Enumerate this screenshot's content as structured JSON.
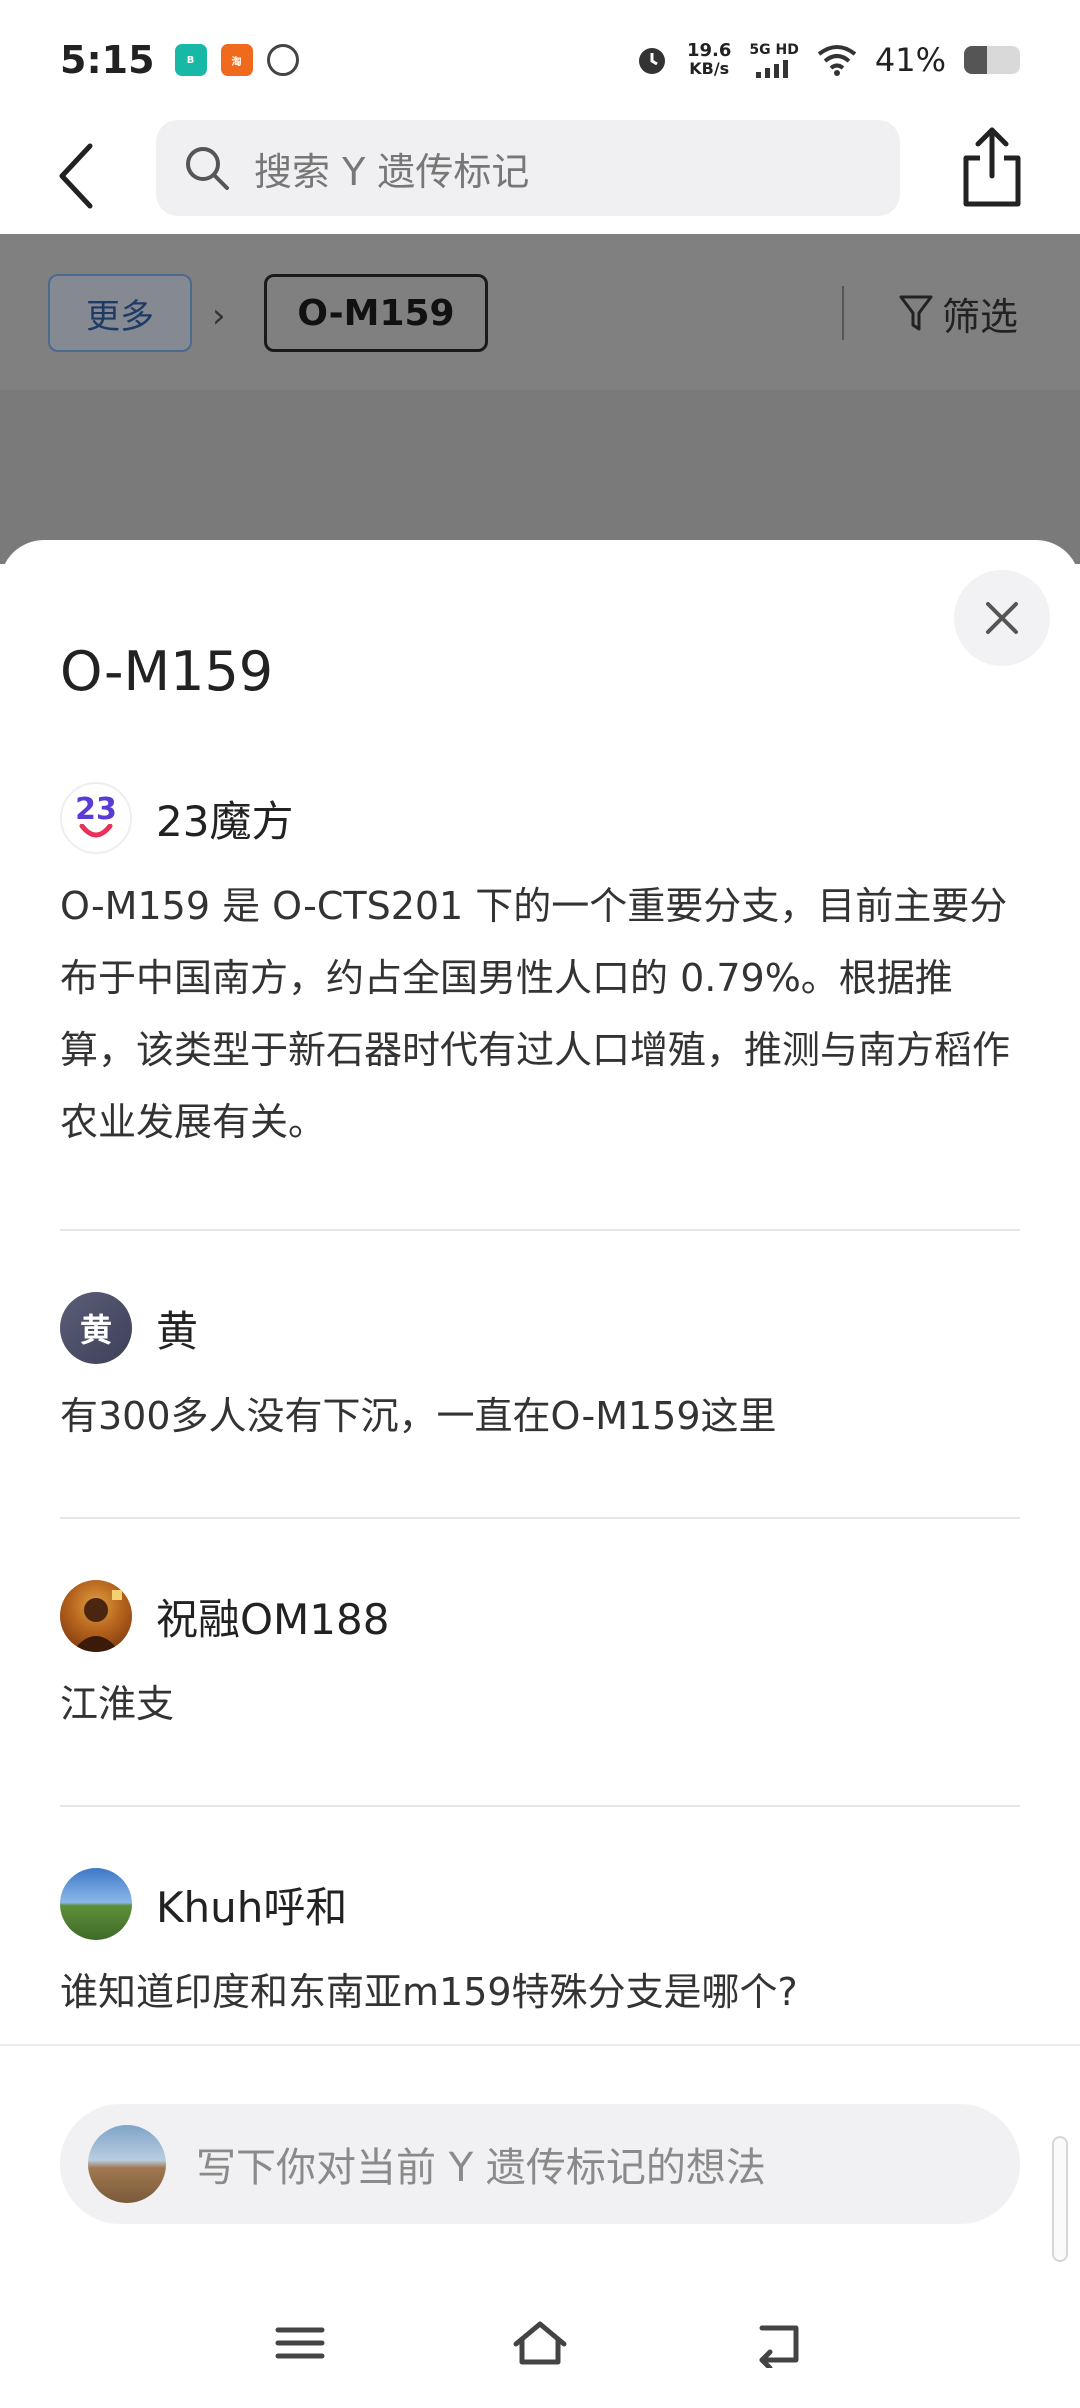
{
  "status_bar": {
    "time": "5:15",
    "net_speed_value": "19.6",
    "net_speed_unit": "KB/s",
    "network": "5G HD",
    "battery_percent": "41%",
    "battery_level": 0.41,
    "app_icons": [
      "boss-zhipin-icon",
      "taobao-icon",
      "clock-app-icon"
    ]
  },
  "app_bar": {
    "search_placeholder": "搜索 Y 遗传标记"
  },
  "filter_strip": {
    "more_label": "更多",
    "separator": "›",
    "current_crumb": "O-M159",
    "filter_label": "筛选"
  },
  "sheet": {
    "title": "O-M159",
    "entries": [
      {
        "author": "23魔方",
        "avatar_text": "23",
        "text": "O-M159 是 O-CTS201 下的一个重要分支，目前主要分布于中国南方，约占全国男性人口的 0.79%。根据推算，该类型于新石器时代有过人口增殖，推测与南方稻作农业发展有关。"
      },
      {
        "author": "黄",
        "avatar_text": "黄",
        "text": "有300多人没有下沉，一直在O-M159这里"
      },
      {
        "author": "祝融OM188",
        "avatar_text": "",
        "text": "江淮支"
      },
      {
        "author": "Khuh呼和",
        "avatar_text": "",
        "text": "谁知道印度和东南亚m159特殊分支是哪个?"
      }
    ]
  },
  "comment_bar": {
    "placeholder": "写下你对当前 Y 遗传标记的想法"
  },
  "colors": {
    "accent_blue": "#1e3a66",
    "overlay_gray": "#7a7a7a",
    "sheet_bg": "#ffffff"
  }
}
